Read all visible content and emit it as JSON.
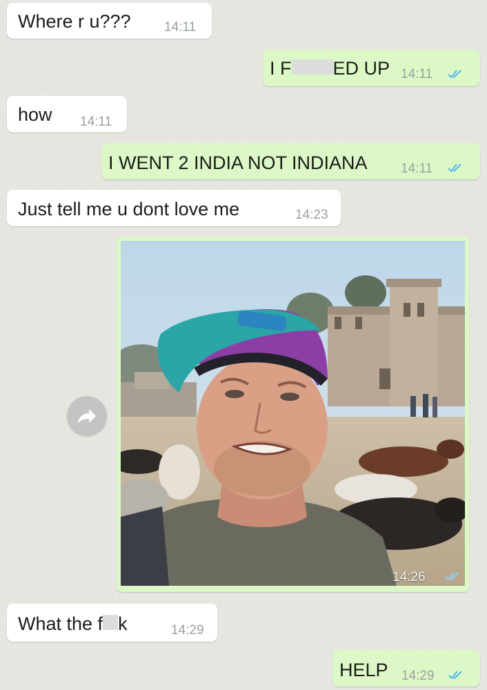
{
  "messages": [
    {
      "dir": "in",
      "text": "Where r u???",
      "time": "14:11"
    },
    {
      "dir": "out",
      "text_before": "I F",
      "text_after": "ED UP",
      "time": "14:11",
      "read": true
    },
    {
      "dir": "in",
      "text": "how",
      "time": "14:11"
    },
    {
      "dir": "out",
      "text": "I WENT 2 INDIA NOT INDIANA",
      "time": "14:11",
      "read": true
    },
    {
      "dir": "in",
      "text": "Just tell me u dont love me",
      "time": "14:23"
    },
    {
      "dir": "out",
      "type": "image",
      "time": "14:26",
      "read": true,
      "image_description_icon": "selfie-photo"
    },
    {
      "dir": "in",
      "text_before": "What the f",
      "text_after": "k",
      "time": "14:29"
    },
    {
      "dir": "out",
      "text": "HELP",
      "time": "14:29",
      "read": true
    }
  ],
  "icons": {
    "forward": "forward-arrow-icon",
    "read_receipt": "double-check-icon"
  },
  "colors": {
    "incoming_bubble": "#ffffff",
    "outgoing_bubble": "#dcf8c6",
    "read_ticks": "#4fb6ec",
    "background": "#e8e6e1"
  }
}
